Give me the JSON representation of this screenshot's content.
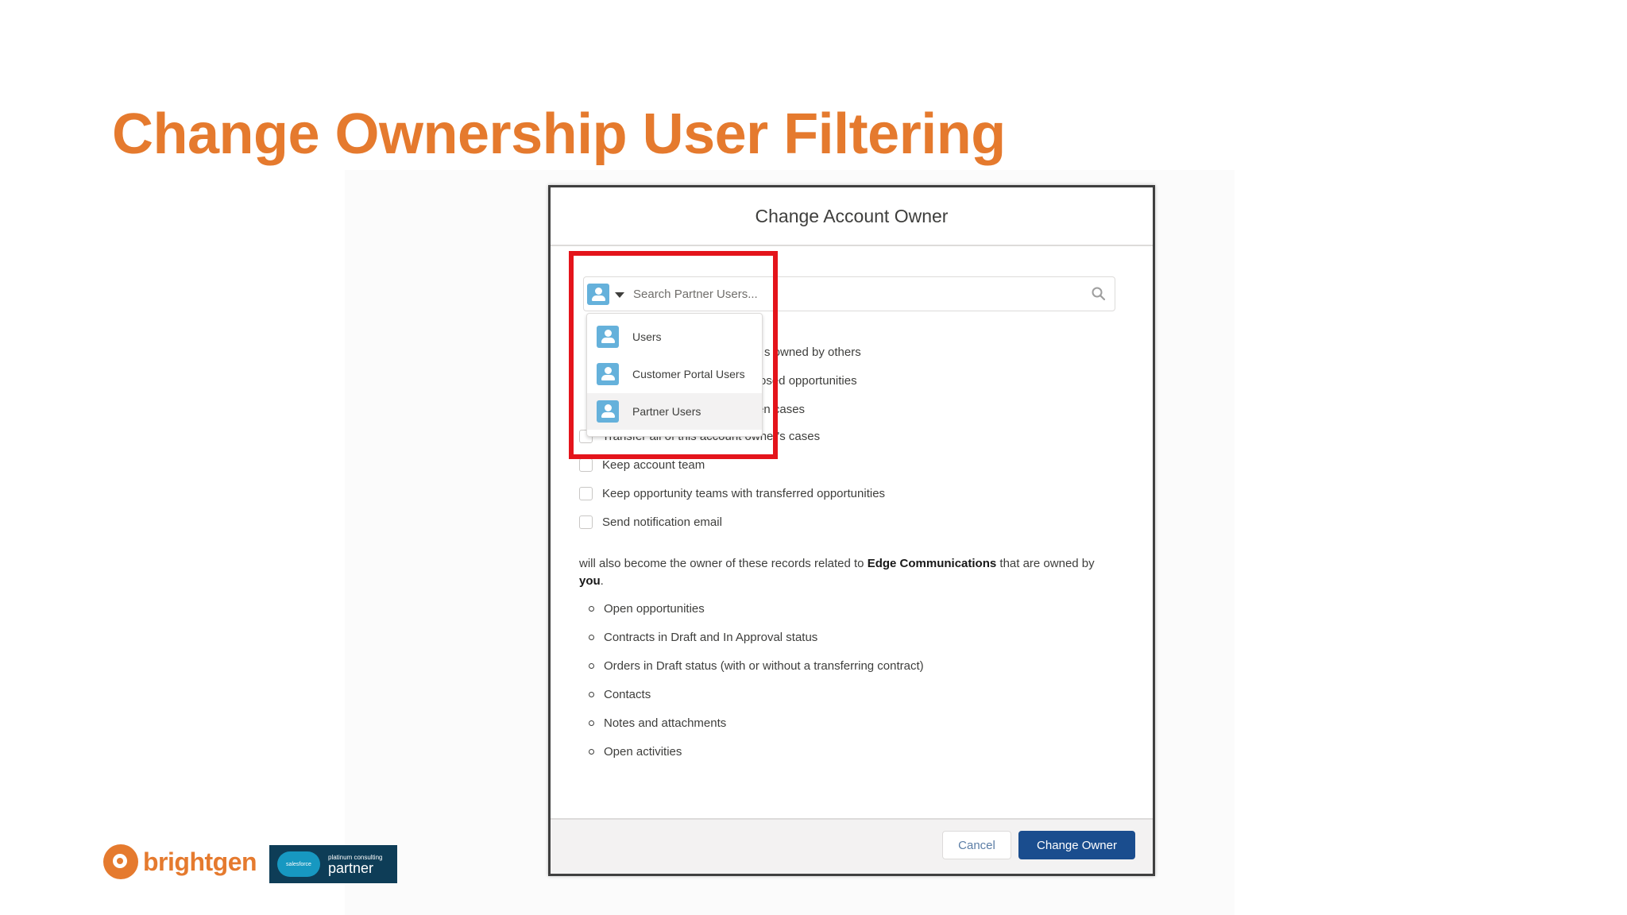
{
  "slide": {
    "title": "Change Ownership User Filtering",
    "accent_color": "#e57a2e",
    "highlight_color": "#e4141b"
  },
  "modal": {
    "title": "Change Account Owner",
    "search": {
      "placeholder": "Search Partner Users...",
      "value": "",
      "object_icon": "user-icon",
      "search_icon": "search-icon"
    },
    "object_menu": {
      "items": [
        {
          "label": "Users",
          "icon": "user-icon",
          "selected": false
        },
        {
          "label": "Customer Portal Users",
          "icon": "user-icon",
          "selected": false
        },
        {
          "label": "Partner Users",
          "icon": "user-icon",
          "selected": true
        }
      ]
    },
    "partially_hidden_options": [
      {
        "visible_text": "s owned by others"
      },
      {
        "visible_text": "osed opportunities"
      },
      {
        "visible_text": "en cases"
      }
    ],
    "options": [
      {
        "label": "Transfer all of this account owner's cases",
        "checked": false
      },
      {
        "label": "Keep account team",
        "checked": false
      },
      {
        "label": "Keep opportunity teams with transferred opportunities",
        "checked": false
      },
      {
        "label": "Send notification email",
        "checked": false
      }
    ],
    "info": {
      "text_before": "will also become the owner of these records related to ",
      "account_name": "Edge Communications",
      "text_middle": " that are owned by ",
      "owner": "you",
      "text_end": "."
    },
    "records": [
      "Open opportunities",
      "Contracts in Draft and In Approval status",
      "Orders in Draft status (with or without a transferring contract)",
      "Contacts",
      "Notes and attachments",
      "Open activities"
    ],
    "footer": {
      "cancel_label": "Cancel",
      "primary_label": "Change Owner",
      "primary_color": "#1a4d8e"
    }
  },
  "branding": {
    "company": "brightgen",
    "partner_small": "platinum consulting",
    "partner_big": "partner",
    "salesforce_text": "salesforce"
  }
}
